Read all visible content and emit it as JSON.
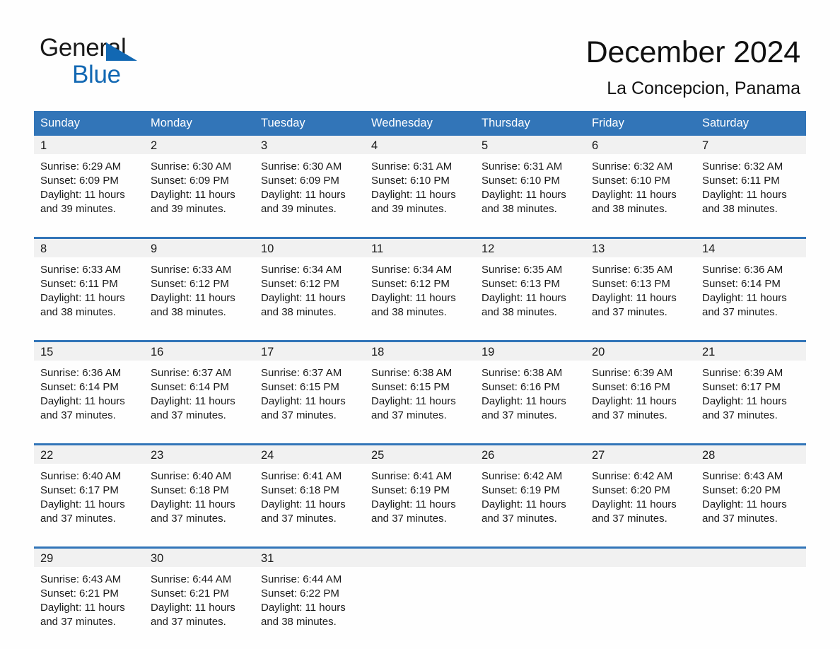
{
  "brand": {
    "name_part1": "General",
    "name_part2": "Blue",
    "triangle_icon": "triangle-logo-icon",
    "accent_color": "#1268b3"
  },
  "header": {
    "title": "December 2024",
    "subtitle": "La Concepcion, Panama"
  },
  "theme": {
    "header_blue": "#3275b8",
    "row_divider_blue": "#3275b8",
    "date_band_gray": "#f1f1f1",
    "text_color": "#1a1a1a",
    "page_background": "#fefefe"
  },
  "calendar": {
    "weekday_headers": [
      "Sunday",
      "Monday",
      "Tuesday",
      "Wednesday",
      "Thursday",
      "Friday",
      "Saturday"
    ],
    "weeks": [
      [
        {
          "day": "1",
          "sunrise": "Sunrise: 6:29 AM",
          "sunset": "Sunset: 6:09 PM",
          "daylight_line1": "Daylight: 11 hours",
          "daylight_line2": "and 39 minutes."
        },
        {
          "day": "2",
          "sunrise": "Sunrise: 6:30 AM",
          "sunset": "Sunset: 6:09 PM",
          "daylight_line1": "Daylight: 11 hours",
          "daylight_line2": "and 39 minutes."
        },
        {
          "day": "3",
          "sunrise": "Sunrise: 6:30 AM",
          "sunset": "Sunset: 6:09 PM",
          "daylight_line1": "Daylight: 11 hours",
          "daylight_line2": "and 39 minutes."
        },
        {
          "day": "4",
          "sunrise": "Sunrise: 6:31 AM",
          "sunset": "Sunset: 6:10 PM",
          "daylight_line1": "Daylight: 11 hours",
          "daylight_line2": "and 39 minutes."
        },
        {
          "day": "5",
          "sunrise": "Sunrise: 6:31 AM",
          "sunset": "Sunset: 6:10 PM",
          "daylight_line1": "Daylight: 11 hours",
          "daylight_line2": "and 38 minutes."
        },
        {
          "day": "6",
          "sunrise": "Sunrise: 6:32 AM",
          "sunset": "Sunset: 6:10 PM",
          "daylight_line1": "Daylight: 11 hours",
          "daylight_line2": "and 38 minutes."
        },
        {
          "day": "7",
          "sunrise": "Sunrise: 6:32 AM",
          "sunset": "Sunset: 6:11 PM",
          "daylight_line1": "Daylight: 11 hours",
          "daylight_line2": "and 38 minutes."
        }
      ],
      [
        {
          "day": "8",
          "sunrise": "Sunrise: 6:33 AM",
          "sunset": "Sunset: 6:11 PM",
          "daylight_line1": "Daylight: 11 hours",
          "daylight_line2": "and 38 minutes."
        },
        {
          "day": "9",
          "sunrise": "Sunrise: 6:33 AM",
          "sunset": "Sunset: 6:12 PM",
          "daylight_line1": "Daylight: 11 hours",
          "daylight_line2": "and 38 minutes."
        },
        {
          "day": "10",
          "sunrise": "Sunrise: 6:34 AM",
          "sunset": "Sunset: 6:12 PM",
          "daylight_line1": "Daylight: 11 hours",
          "daylight_line2": "and 38 minutes."
        },
        {
          "day": "11",
          "sunrise": "Sunrise: 6:34 AM",
          "sunset": "Sunset: 6:12 PM",
          "daylight_line1": "Daylight: 11 hours",
          "daylight_line2": "and 38 minutes."
        },
        {
          "day": "12",
          "sunrise": "Sunrise: 6:35 AM",
          "sunset": "Sunset: 6:13 PM",
          "daylight_line1": "Daylight: 11 hours",
          "daylight_line2": "and 38 minutes."
        },
        {
          "day": "13",
          "sunrise": "Sunrise: 6:35 AM",
          "sunset": "Sunset: 6:13 PM",
          "daylight_line1": "Daylight: 11 hours",
          "daylight_line2": "and 37 minutes."
        },
        {
          "day": "14",
          "sunrise": "Sunrise: 6:36 AM",
          "sunset": "Sunset: 6:14 PM",
          "daylight_line1": "Daylight: 11 hours",
          "daylight_line2": "and 37 minutes."
        }
      ],
      [
        {
          "day": "15",
          "sunrise": "Sunrise: 6:36 AM",
          "sunset": "Sunset: 6:14 PM",
          "daylight_line1": "Daylight: 11 hours",
          "daylight_line2": "and 37 minutes."
        },
        {
          "day": "16",
          "sunrise": "Sunrise: 6:37 AM",
          "sunset": "Sunset: 6:14 PM",
          "daylight_line1": "Daylight: 11 hours",
          "daylight_line2": "and 37 minutes."
        },
        {
          "day": "17",
          "sunrise": "Sunrise: 6:37 AM",
          "sunset": "Sunset: 6:15 PM",
          "daylight_line1": "Daylight: 11 hours",
          "daylight_line2": "and 37 minutes."
        },
        {
          "day": "18",
          "sunrise": "Sunrise: 6:38 AM",
          "sunset": "Sunset: 6:15 PM",
          "daylight_line1": "Daylight: 11 hours",
          "daylight_line2": "and 37 minutes."
        },
        {
          "day": "19",
          "sunrise": "Sunrise: 6:38 AM",
          "sunset": "Sunset: 6:16 PM",
          "daylight_line1": "Daylight: 11 hours",
          "daylight_line2": "and 37 minutes."
        },
        {
          "day": "20",
          "sunrise": "Sunrise: 6:39 AM",
          "sunset": "Sunset: 6:16 PM",
          "daylight_line1": "Daylight: 11 hours",
          "daylight_line2": "and 37 minutes."
        },
        {
          "day": "21",
          "sunrise": "Sunrise: 6:39 AM",
          "sunset": "Sunset: 6:17 PM",
          "daylight_line1": "Daylight: 11 hours",
          "daylight_line2": "and 37 minutes."
        }
      ],
      [
        {
          "day": "22",
          "sunrise": "Sunrise: 6:40 AM",
          "sunset": "Sunset: 6:17 PM",
          "daylight_line1": "Daylight: 11 hours",
          "daylight_line2": "and 37 minutes."
        },
        {
          "day": "23",
          "sunrise": "Sunrise: 6:40 AM",
          "sunset": "Sunset: 6:18 PM",
          "daylight_line1": "Daylight: 11 hours",
          "daylight_line2": "and 37 minutes."
        },
        {
          "day": "24",
          "sunrise": "Sunrise: 6:41 AM",
          "sunset": "Sunset: 6:18 PM",
          "daylight_line1": "Daylight: 11 hours",
          "daylight_line2": "and 37 minutes."
        },
        {
          "day": "25",
          "sunrise": "Sunrise: 6:41 AM",
          "sunset": "Sunset: 6:19 PM",
          "daylight_line1": "Daylight: 11 hours",
          "daylight_line2": "and 37 minutes."
        },
        {
          "day": "26",
          "sunrise": "Sunrise: 6:42 AM",
          "sunset": "Sunset: 6:19 PM",
          "daylight_line1": "Daylight: 11 hours",
          "daylight_line2": "and 37 minutes."
        },
        {
          "day": "27",
          "sunrise": "Sunrise: 6:42 AM",
          "sunset": "Sunset: 6:20 PM",
          "daylight_line1": "Daylight: 11 hours",
          "daylight_line2": "and 37 minutes."
        },
        {
          "day": "28",
          "sunrise": "Sunrise: 6:43 AM",
          "sunset": "Sunset: 6:20 PM",
          "daylight_line1": "Daylight: 11 hours",
          "daylight_line2": "and 37 minutes."
        }
      ],
      [
        {
          "day": "29",
          "sunrise": "Sunrise: 6:43 AM",
          "sunset": "Sunset: 6:21 PM",
          "daylight_line1": "Daylight: 11 hours",
          "daylight_line2": "and 37 minutes."
        },
        {
          "day": "30",
          "sunrise": "Sunrise: 6:44 AM",
          "sunset": "Sunset: 6:21 PM",
          "daylight_line1": "Daylight: 11 hours",
          "daylight_line2": "and 37 minutes."
        },
        {
          "day": "31",
          "sunrise": "Sunrise: 6:44 AM",
          "sunset": "Sunset: 6:22 PM",
          "daylight_line1": "Daylight: 11 hours",
          "daylight_line2": "and 38 minutes."
        },
        {
          "day": "",
          "sunrise": "",
          "sunset": "",
          "daylight_line1": "",
          "daylight_line2": ""
        },
        {
          "day": "",
          "sunrise": "",
          "sunset": "",
          "daylight_line1": "",
          "daylight_line2": ""
        },
        {
          "day": "",
          "sunrise": "",
          "sunset": "",
          "daylight_line1": "",
          "daylight_line2": ""
        },
        {
          "day": "",
          "sunrise": "",
          "sunset": "",
          "daylight_line1": "",
          "daylight_line2": ""
        }
      ]
    ]
  }
}
